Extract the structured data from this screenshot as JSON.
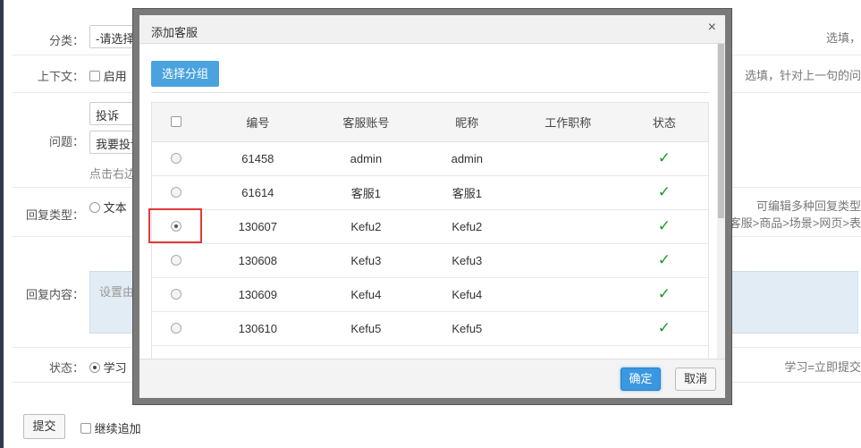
{
  "form": {
    "category": {
      "label": "分类：",
      "value": "-请选择分",
      "hint": "选填，"
    },
    "context": {
      "label": "上下文：",
      "option": "启用",
      "hint": "选填，针对上一句的问"
    },
    "question": {
      "label": "问题：",
      "value1": "投诉",
      "value2": "我要投诉",
      "note": "点击右边的"
    },
    "reply_type": {
      "label": "回复类型：",
      "option": "文本",
      "hint1": "可编辑多种回复类型",
      "hint2": "客服>商品>场景>网页>表"
    },
    "reply_content": {
      "label": "回复内容：",
      "placeholder": "设置由指"
    },
    "status": {
      "label": "状态：",
      "option": "学习",
      "hint": "学习=立即提交"
    },
    "submit_label": "提交",
    "continue_label": "继续追加"
  },
  "modal": {
    "title": "添加客服",
    "close_symbol": "×",
    "group_button": "选择分组",
    "columns": [
      "编号",
      "客服账号",
      "昵称",
      "工作职称",
      "状态"
    ],
    "rows": [
      {
        "id": "61458",
        "account": "admin",
        "nickname": "admin",
        "title": "",
        "status": "✓",
        "selected": false
      },
      {
        "id": "61614",
        "account": "客服1",
        "nickname": "客服1",
        "title": "",
        "status": "✓",
        "selected": false
      },
      {
        "id": "130607",
        "account": "Kefu2",
        "nickname": "Kefu2",
        "title": "",
        "status": "✓",
        "selected": true
      },
      {
        "id": "130608",
        "account": "Kefu3",
        "nickname": "Kefu3",
        "title": "",
        "status": "✓",
        "selected": false
      },
      {
        "id": "130609",
        "account": "Kefu4",
        "nickname": "Kefu4",
        "title": "",
        "status": "✓",
        "selected": false
      },
      {
        "id": "130610",
        "account": "Kefu5",
        "nickname": "Kefu5",
        "title": "",
        "status": "✓",
        "selected": false
      }
    ],
    "confirm_label": "确定",
    "cancel_label": "取消"
  },
  "colors": {
    "primary": "#3a97e0",
    "success": "#1a9a2a",
    "highlight": "#e03a3a"
  }
}
